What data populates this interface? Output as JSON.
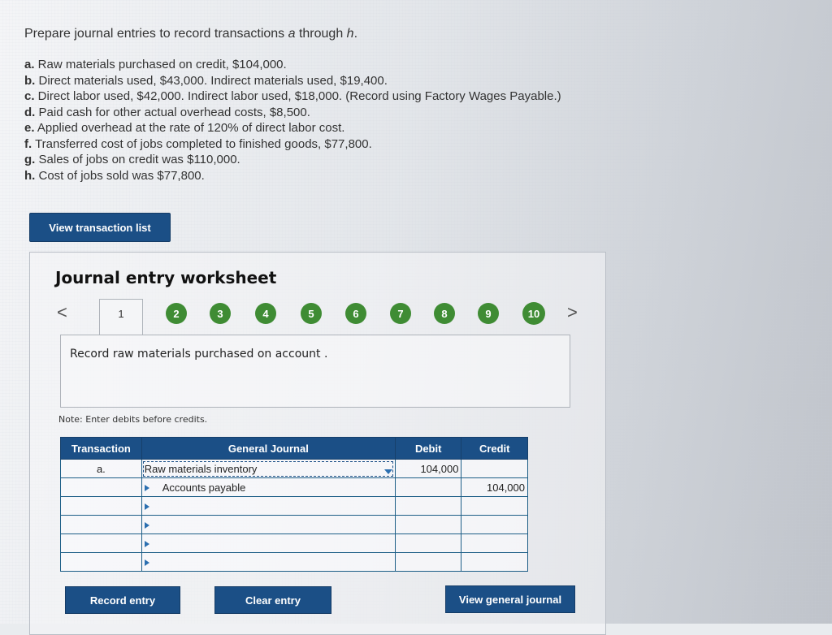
{
  "heading": {
    "prefix": "Prepare journal entries to record transactions ",
    "a": "a",
    "middle": " through ",
    "h": "h",
    "suffix": "."
  },
  "transactions": [
    {
      "letter": "a.",
      "text": " Raw materials purchased on credit, $104,000."
    },
    {
      "letter": "b.",
      "text": " Direct materials used, $43,000. Indirect materials used, $19,400."
    },
    {
      "letter": "c.",
      "text": " Direct labor used, $42,000. Indirect labor used, $18,000. (Record using Factory Wages Payable.)"
    },
    {
      "letter": "d.",
      "text": " Paid cash for other actual overhead costs, $8,500."
    },
    {
      "letter": "e.",
      "text": " Applied overhead at the rate of 120% of direct labor cost."
    },
    {
      "letter": "f.",
      "text": " Transferred cost of jobs completed to finished goods, $77,800."
    },
    {
      "letter": "g.",
      "text": " Sales of jobs on credit was $110,000."
    },
    {
      "letter": "h.",
      "text": " Cost of jobs sold was $77,800."
    }
  ],
  "buttons": {
    "view_transaction_list": "View transaction list",
    "record_entry": "Record entry",
    "clear_entry": "Clear entry",
    "view_general_journal": "View general journal"
  },
  "worksheet": {
    "title": "Journal entry worksheet",
    "prev": "<",
    "next": ">",
    "steps": [
      "1",
      "2",
      "3",
      "4",
      "5",
      "6",
      "7",
      "8",
      "9",
      "10"
    ],
    "active_step": "1",
    "instruction": "Record raw materials purchased on account .",
    "note": "Note: Enter debits before credits."
  },
  "journal": {
    "headers": {
      "transaction": "Transaction",
      "general_journal": "General Journal",
      "debit": "Debit",
      "credit": "Credit"
    },
    "rows": [
      {
        "transaction": "a.",
        "account": "Raw materials inventory",
        "debit": "104,000",
        "credit": ""
      },
      {
        "transaction": "",
        "account": "Accounts payable",
        "debit": "",
        "credit": "104,000"
      },
      {
        "transaction": "",
        "account": "",
        "debit": "",
        "credit": ""
      },
      {
        "transaction": "",
        "account": "",
        "debit": "",
        "credit": ""
      },
      {
        "transaction": "",
        "account": "",
        "debit": "",
        "credit": ""
      },
      {
        "transaction": "",
        "account": "",
        "debit": "",
        "credit": ""
      }
    ]
  },
  "colors": {
    "button_blue": "#1b4f86",
    "step_green": "#3f8c34",
    "grid_teal": "#1d5e87"
  }
}
